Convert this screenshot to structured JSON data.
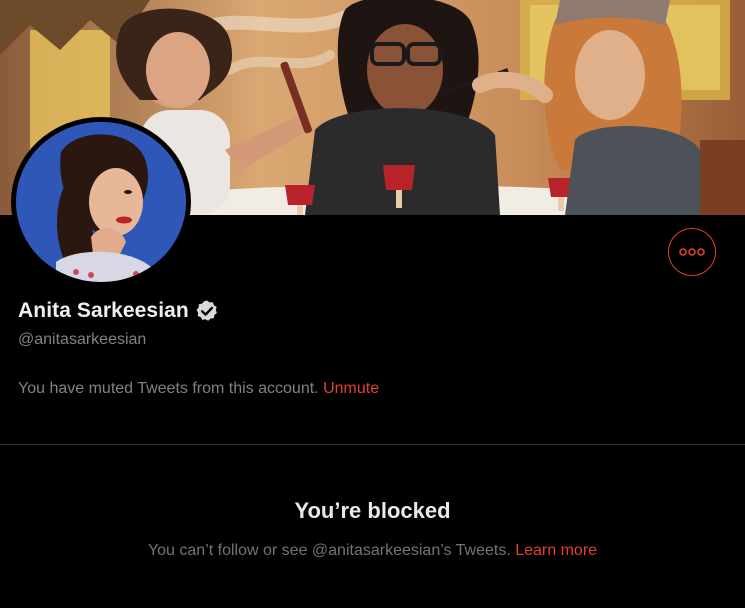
{
  "profile": {
    "display_name": "Anita Sarkeesian",
    "handle": "@anitasarkeesian",
    "verified": true
  },
  "mute_notice": {
    "text": "You have muted Tweets from this account. ",
    "action_label": "Unmute"
  },
  "blocked": {
    "title": "You’re blocked",
    "description": "You can’t follow or see @anitasarkeesian’s Tweets. ",
    "link_label": "Learn more"
  },
  "icons": {
    "more": "more-options-icon",
    "verified": "verified-badge-icon"
  },
  "colors": {
    "background": "#000000",
    "accent": "#e0402c",
    "muted_text": "#7d8388",
    "primary_text": "#e7e9ea",
    "divider": "#2f3336"
  }
}
